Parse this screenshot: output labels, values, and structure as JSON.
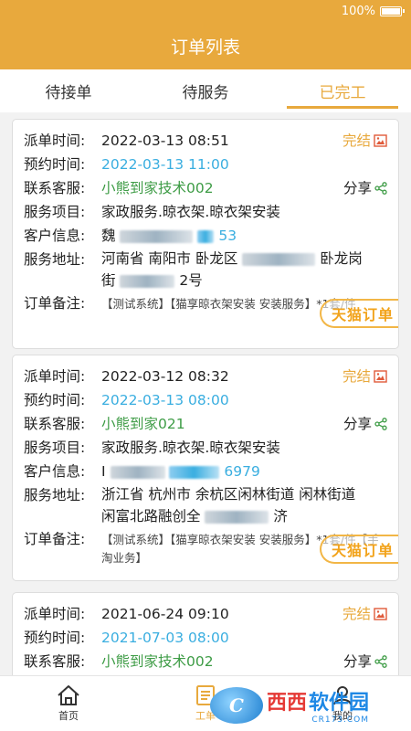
{
  "status_bar": {
    "battery": "100%"
  },
  "header": {
    "title": "订单列表"
  },
  "tabs": [
    {
      "label": "待接单",
      "active": false
    },
    {
      "label": "待服务",
      "active": false
    },
    {
      "label": "已完工",
      "active": true
    }
  ],
  "labels": {
    "dispatch_time": "派单时间:",
    "appointment_time": "预约时间:",
    "service_agent": "联系客服:",
    "service_item": "服务项目:",
    "customer_info": "客户信息:",
    "service_address": "服务地址:",
    "remark": "订单备注:",
    "share": "分享"
  },
  "orders": [
    {
      "status": "完结",
      "dispatch_time": "2022-03-13 08:51",
      "appointment_time": "2022-03-13 11:00",
      "agent": "小熊到家技术002",
      "service_item": "家政服务.晾衣架.晾衣架安装",
      "customer_prefix": "魏",
      "customer_suffix": "53",
      "address_line1_a": "河南省 南阳市 卧龙区",
      "address_line1_b": "卧龙岗",
      "address_line2_a": "街",
      "address_line2_b": "2号",
      "remark": "【测试系统】【猫享晾衣架安装 安装服务】*1套/件",
      "badge": "天猫订单"
    },
    {
      "status": "完结",
      "dispatch_time": "2022-03-12 08:32",
      "appointment_time": "2022-03-13 08:00",
      "agent": "小熊到家021",
      "service_item": "家政服务.晾衣架.晾衣架安装",
      "customer_prefix": "Ⅰ",
      "customer_suffix": "6979",
      "address_line1_a": "浙江省 杭州市 余杭区闲林街道 闲林街道",
      "address_line1_b": "",
      "address_line2_a": "闲富北路融创全",
      "address_line2_b": "济",
      "remark": "【测试系统】【猫享晾衣架安装 安装服务】*1套/件【手淘业务】",
      "badge": "天猫订单"
    },
    {
      "status": "完结",
      "dispatch_time": "2021-06-24 09:10",
      "appointment_time": "2021-07-03 08:00",
      "agent": "小熊到家技术002"
    }
  ],
  "bottom_nav": [
    {
      "label": "首页",
      "icon": "home-icon",
      "active": false
    },
    {
      "label": "工单",
      "icon": "order-list-icon",
      "active": true
    },
    {
      "label": "我的",
      "icon": "profile-icon",
      "active": false
    }
  ],
  "watermark": {
    "logo_text": "C",
    "main_red": "西西",
    "main_blue": "软件园",
    "sub": "CR173.COM"
  },
  "colors": {
    "accent": "#e8a93d",
    "blue_text": "#3aaee0",
    "green_text": "#3e9c46"
  }
}
